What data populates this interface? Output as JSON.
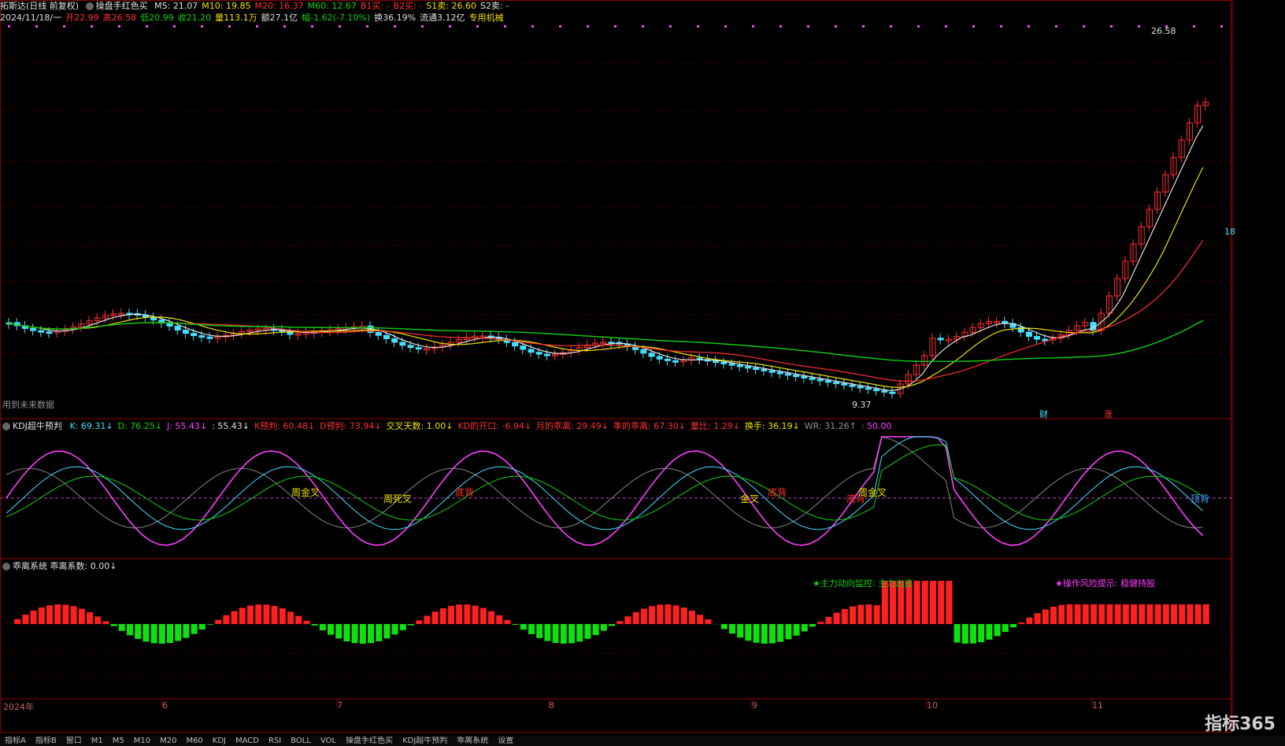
{
  "header": {
    "title": "拓斯达(日线 前复权)",
    "indicator_name": "操盘手红色买",
    "ma": [
      {
        "label": "M5: 21.07",
        "color": "#e0e0e0"
      },
      {
        "label": "M10: 19.85",
        "color": "#f0e000"
      },
      {
        "label": "M20: 16.37",
        "color": "#ff3030"
      },
      {
        "label": "M60: 12.67",
        "color": "#10d010"
      },
      {
        "label": "B1买: -",
        "color": "#ff3030"
      },
      {
        "label": "B2买: -",
        "color": "#ff3030"
      },
      {
        "label": "S1卖: 26.60",
        "color": "#f0e000"
      },
      {
        "label": "S2卖: -",
        "color": "#e0e0e0"
      }
    ],
    "quote": [
      {
        "label": "2024/11/18/一",
        "color": "#e0e0e0"
      },
      {
        "label": "开22.99",
        "color": "#ff3030"
      },
      {
        "label": "高26.58",
        "color": "#ff3030"
      },
      {
        "label": "低20.99",
        "color": "#10d010"
      },
      {
        "label": "收21.20",
        "color": "#10d010"
      },
      {
        "label": "量113.1万",
        "color": "#f0e000"
      },
      {
        "label": "额27.1亿",
        "color": "#e0e0e0"
      },
      {
        "label": "幅-1.62(-7.10%)",
        "color": "#10d010"
      },
      {
        "label": "换36.19%",
        "color": "#e0e0e0"
      },
      {
        "label": "流通3.12亿",
        "color": "#e0e0e0"
      },
      {
        "label": "专用机械",
        "color": "#f0e000"
      }
    ],
    "future_text": "用到未来数据"
  },
  "price_labels": {
    "high": "26.58",
    "low": "9.37",
    "side": "18"
  },
  "event_tags": {
    "cai": "财",
    "zhang": "涨"
  },
  "kdj": {
    "title": "KDJ超牛预判",
    "values": [
      {
        "label": "K: 69.31↓",
        "color": "#40e0ff"
      },
      {
        "label": "D: 76.25↓",
        "color": "#10d010"
      },
      {
        "label": "J: 55.43↓",
        "color": "#ff40ff"
      },
      {
        "label": ": 55.43↓",
        "color": "#e0e0e0"
      },
      {
        "label": "K预判: 60.48↓",
        "color": "#ff3030"
      },
      {
        "label": "D预判: 73.94↓",
        "color": "#ff3030"
      },
      {
        "label": "交叉天数: 1.00↓",
        "color": "#f0e000"
      },
      {
        "label": "KD的开口: -6.94↓",
        "color": "#ff3030"
      },
      {
        "label": "月的乖离: 29.49↓",
        "color": "#ff3030"
      },
      {
        "label": "季的乖离: 67.30↓",
        "color": "#ff3030"
      },
      {
        "label": "量比: 1.29↓",
        "color": "#ff3030"
      },
      {
        "label": "换手: 36.19↓",
        "color": "#f0e000"
      },
      {
        "label": "WR: 31.26↑",
        "color": "#909090"
      },
      {
        "label": ": 50.00",
        "color": "#ff40ff"
      }
    ],
    "annotations": [
      "周金叉",
      "周死叉",
      "底背",
      "金叉",
      "底背",
      "底背",
      "周金叉",
      "顶背"
    ]
  },
  "bias": {
    "title": "乖离系统",
    "value": "乖离系数: 0.00↓",
    "note1": "★主力动向监控: 主力出逃",
    "note2": "★操作风险提示: 稳健持股"
  },
  "months": [
    "2024年",
    "6",
    "7",
    "8",
    "9",
    "10",
    "11"
  ],
  "toolbar": [
    "指标A",
    "指标B",
    "窗口",
    "M1",
    "M5",
    "M10",
    "M20",
    "M60",
    "KDJ",
    "MACD",
    "RSI",
    "BOLL",
    "VOL",
    "操盘手红色买",
    "KDJ超牛预判",
    "乖离系统",
    "设置"
  ],
  "watermark": "指标365",
  "colors": {
    "up": "#ff3030",
    "down": "#40e0ff",
    "ma5": "#e0e0e0",
    "ma10": "#f0e000",
    "ma20": "#ff3030",
    "ma60": "#10d010"
  }
}
